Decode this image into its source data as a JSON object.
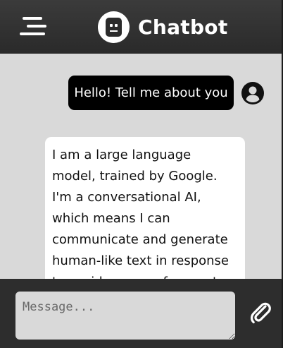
{
  "header": {
    "menu_icon": "hamburger-menu-icon",
    "logo_icon": "robot-icon",
    "title": "Chatbot"
  },
  "messages": [
    {
      "role": "user",
      "text": "Hello! Tell me about you",
      "avatar_icon": "user-circle-icon"
    },
    {
      "role": "bot",
      "text": "I am a large language model, trained by Google. I'm a conversational AI, which means I can communicate and generate human-like text in response to a wide range of prompts and questions."
    }
  ],
  "composer": {
    "placeholder": "Message...",
    "value": "",
    "attach_icon": "paperclip-icon"
  },
  "colors": {
    "header_bg": "#2f2f2f",
    "chat_bg": "#d9d9d9",
    "user_bubble": "#000000",
    "bot_bubble": "#ffffff",
    "footer_bg": "#2d2d2d"
  }
}
